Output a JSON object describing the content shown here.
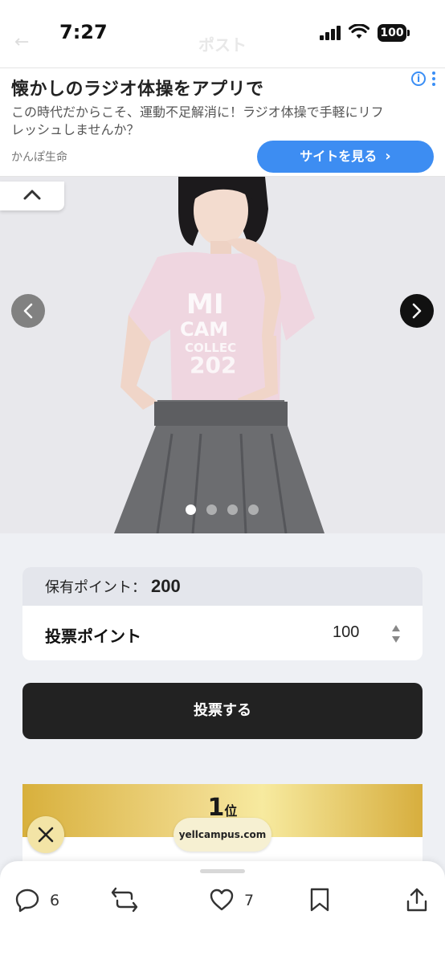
{
  "status_bar": {
    "time": "7:27",
    "battery": "100",
    "background_title": "ポスト"
  },
  "ad": {
    "title": "懐かしのラジオ体操をアプリで",
    "description": "この時代だからこそ、運動不足解消に！ラジオ体操で手軽にリフレッシュしませんか？",
    "source": "かんぽ生命",
    "cta_label": "サイトを見る",
    "info_label": "i"
  },
  "carousel": {
    "slide_count": 4,
    "active_index": 0
  },
  "points": {
    "held_label": "保有ポイント：",
    "held_value": "200",
    "vote_label": "投票ポイント",
    "vote_value": "100"
  },
  "vote_button": "投票する",
  "rank": {
    "number": "1",
    "suffix": "位"
  },
  "url_pill": "yellcampus.com",
  "actions": {
    "replies": "6",
    "likes": "7"
  },
  "colors": {
    "accent_blue": "#3d8df2",
    "gold": "#e0bb4c",
    "dark_button": "#222222"
  }
}
